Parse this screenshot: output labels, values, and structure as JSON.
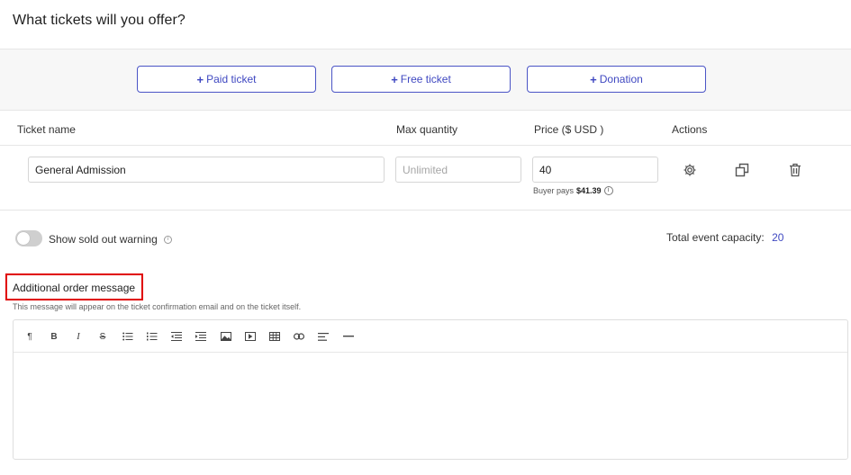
{
  "page": {
    "title": "What tickets will you offer?"
  },
  "add_buttons": [
    {
      "label": "Paid ticket"
    },
    {
      "label": "Free ticket"
    },
    {
      "label": "Donation"
    }
  ],
  "table": {
    "headers": {
      "ticket_name": "Ticket name",
      "max_quantity": "Max quantity",
      "price": "Price ($ USD )",
      "actions": "Actions"
    },
    "row": {
      "ticket_name": "General Admission",
      "max_quantity_value": "",
      "max_quantity_placeholder": "Unlimited",
      "price": "40",
      "buyer_pays_label": "Buyer pays",
      "buyer_pays_value": "$41.39"
    },
    "action_icons": [
      "gear-icon",
      "duplicate-icon",
      "trash-icon"
    ]
  },
  "soldout": {
    "label": "Show sold out warning",
    "enabled": false
  },
  "capacity": {
    "label": "Total event capacity:",
    "value": "20"
  },
  "order_message": {
    "title": "Additional order message",
    "help": "This message will appear on the ticket confirmation email and on the ticket itself.",
    "content": ""
  },
  "editor_toolbar": [
    "paragraph-icon",
    "bold-icon",
    "italic-icon",
    "strikethrough-icon",
    "bullet-list-icon",
    "numbered-list-icon",
    "outdent-icon",
    "indent-icon",
    "image-icon",
    "video-icon",
    "table-icon",
    "link-icon",
    "align-icon",
    "horizontal-rule-icon"
  ],
  "colors": {
    "accent": "#3f48c1",
    "highlight_border": "#e00000"
  }
}
